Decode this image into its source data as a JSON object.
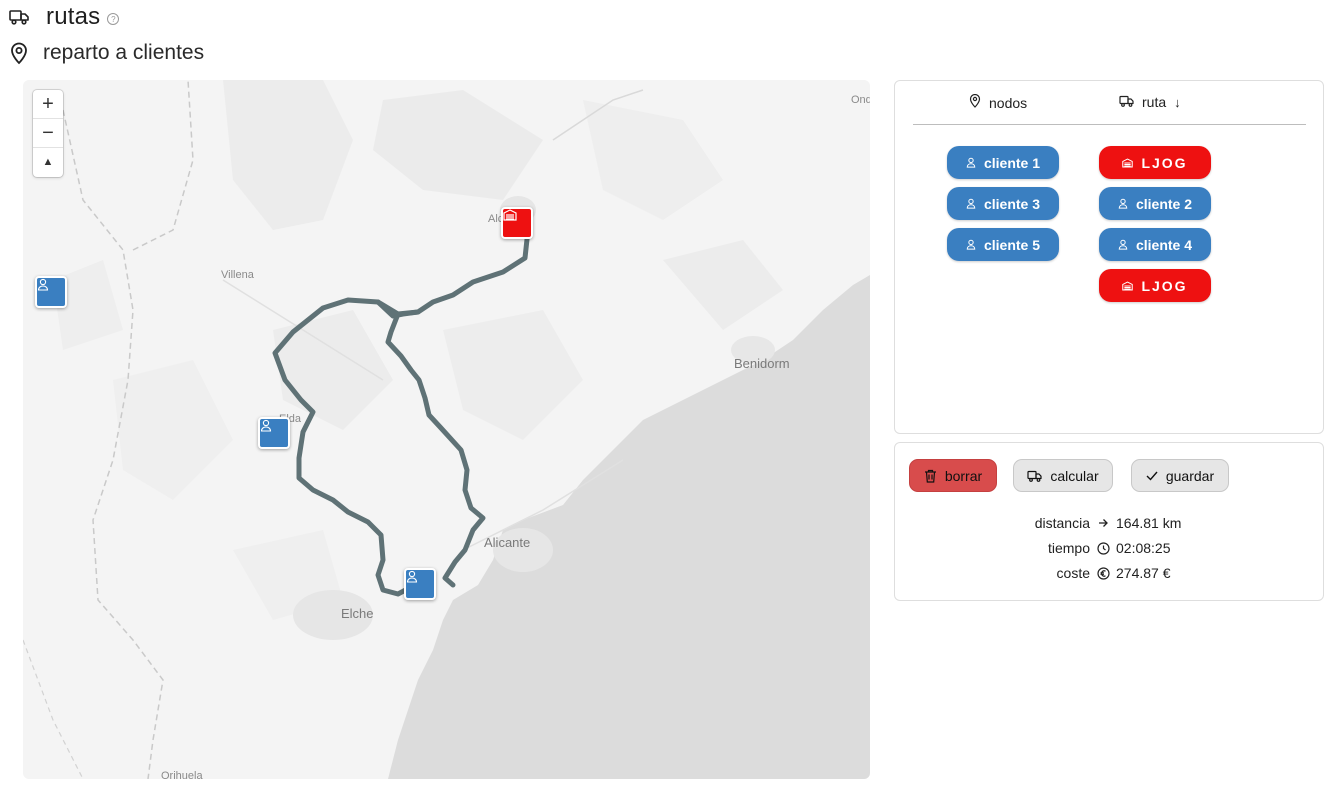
{
  "header": {
    "title": "rutas",
    "subtitle": "reparto a clientes"
  },
  "map": {
    "controls": {
      "zoom_in": "+",
      "zoom_out": "−",
      "compass": "▲"
    },
    "labels": {
      "alcoy": "Alcoy",
      "villena": "Villena",
      "elda": "Elda",
      "benidorm": "Benidorm",
      "alicante": "Alicante",
      "elche": "Elche",
      "orihuela": "Orihuela",
      "ond": "Ond"
    },
    "route_color": "#5f7276",
    "pin_colors": {
      "customer": "#3a7fc1",
      "depot": "#ee1111"
    }
  },
  "panel_nodes": {
    "tabs": [
      {
        "label": "nodos",
        "icon": "map-pin-icon"
      },
      {
        "label": "ruta",
        "icon": "truck-icon",
        "sort": "↓"
      }
    ],
    "nodes_list": [
      {
        "label": "cliente 1",
        "icon": "user-icon"
      },
      {
        "label": "cliente 3",
        "icon": "user-icon"
      },
      {
        "label": "cliente 5",
        "icon": "user-icon"
      }
    ],
    "route_list": [
      {
        "label": "LJOG",
        "icon": "warehouse-icon",
        "kind": "depot"
      },
      {
        "label": "cliente 2",
        "icon": "user-icon",
        "kind": "customer"
      },
      {
        "label": "cliente 4",
        "icon": "user-icon",
        "kind": "customer"
      },
      {
        "label": "LJOG",
        "icon": "warehouse-icon",
        "kind": "depot"
      }
    ]
  },
  "panel_actions": {
    "buttons": {
      "delete": "borrar",
      "calculate": "calcular",
      "save": "guardar"
    },
    "stats": [
      {
        "key": "distancia",
        "icon": "arrow-right-icon",
        "value": "164.81 km"
      },
      {
        "key": "tiempo",
        "icon": "clock-icon",
        "value": "02:08:25"
      },
      {
        "key": "coste",
        "icon": "euro-icon",
        "value": "274.87 €"
      }
    ]
  }
}
